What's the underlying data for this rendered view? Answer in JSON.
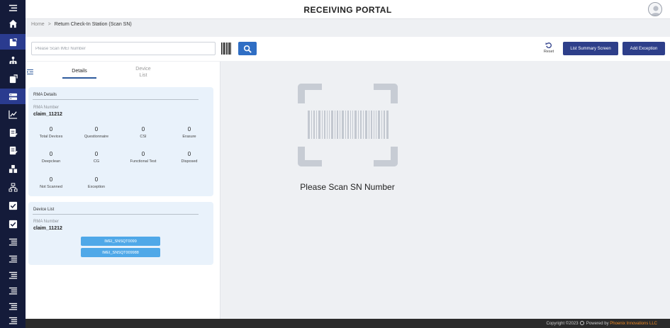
{
  "app": {
    "title": "RECEIVING PORTAL"
  },
  "sidebar": {
    "items": [
      {
        "icon": "menu-icon"
      },
      {
        "icon": "home-icon"
      },
      {
        "icon": "receiving-icon",
        "active": true
      },
      {
        "icon": "org-chart-icon"
      },
      {
        "icon": "document-export-icon"
      },
      {
        "icon": "server-icon",
        "active": true
      },
      {
        "icon": "chart-icon"
      },
      {
        "icon": "edit-document-icon"
      },
      {
        "icon": "edit-document-icon"
      },
      {
        "icon": "warehouse-icon"
      },
      {
        "icon": "network-icon"
      },
      {
        "icon": "checklist-icon"
      },
      {
        "icon": "checklist-icon"
      },
      {
        "icon": "list-icon"
      },
      {
        "icon": "list-icon"
      },
      {
        "icon": "list-icon"
      },
      {
        "icon": "list-icon"
      },
      {
        "icon": "list-icon"
      },
      {
        "icon": "list-icon"
      }
    ]
  },
  "breadcrumb": {
    "home": "Home",
    "separator": ">",
    "current": "Return Check-In Station (Scan SN)"
  },
  "toolbar": {
    "scan_placeholder": "Please Scan IMEI Number",
    "scan_value": "",
    "reset_label": "Reset",
    "summary_label": "List Summary Screen",
    "exception_label": "Add Exception"
  },
  "tabs": {
    "details": "Details",
    "device_list_line1": "Device",
    "device_list_line2": "List"
  },
  "rma_details": {
    "title": "RMA Details",
    "rma_label": "RMA Number",
    "rma_value": "claim_11212",
    "stats": [
      {
        "value": "0",
        "label": "Total Devices"
      },
      {
        "value": "0",
        "label": "Questionnaire"
      },
      {
        "value": "0",
        "label": "CSI"
      },
      {
        "value": "0",
        "label": "Erasure"
      },
      {
        "value": "0",
        "label": "Deepclean"
      },
      {
        "value": "0",
        "label": "CG"
      },
      {
        "value": "0",
        "label": "Functional Test"
      },
      {
        "value": "0",
        "label": "Disposed"
      },
      {
        "value": "0",
        "label": "Not Scanned"
      },
      {
        "value": "0",
        "label": "Exception"
      }
    ]
  },
  "device_list": {
    "title": "Device List",
    "rma_label": "RMA Number",
    "rma_value": "claim_11212",
    "devices": [
      "IMEI_SNSQT0099",
      "IMEI_SNSQT009988"
    ]
  },
  "main": {
    "message": "Please Scan SN Number"
  },
  "footer": {
    "copyright": "Copyright ©2023",
    "powered_by": "Powered by",
    "brand": "Phoenix Innovations LLC"
  },
  "colors": {
    "sidebar": "#141b3a",
    "sidebar_active": "#2a3b8f",
    "primary_button": "#2e3f8a",
    "search_button": "#2f6ec4",
    "imei_button": "#4fa8e8",
    "card_background": "#e9f2fb",
    "footer": "#2b2b2b",
    "brand_accent": "#f08a24"
  }
}
